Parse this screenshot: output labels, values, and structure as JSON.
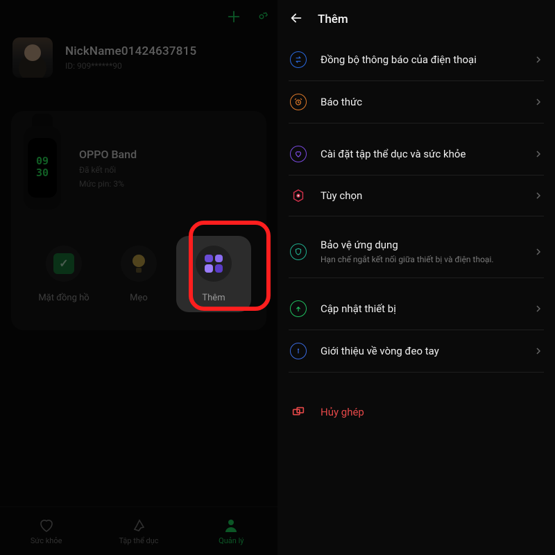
{
  "left": {
    "profile": {
      "nickname": "NickName01424637815",
      "id_label": "ID: 909******90"
    },
    "device": {
      "name": "OPPO Band",
      "status": "Đã kết nối",
      "battery": "Mức pin: 3%",
      "watch_time_top": "09",
      "watch_time_bottom": "30"
    },
    "tiles": {
      "watchface": "Mặt đồng hồ",
      "tips": "Mẹo",
      "more": "Thêm"
    },
    "tabs": {
      "health": "Sức khỏe",
      "fitness": "Tập thể dục",
      "manage": "Quản lý"
    }
  },
  "right": {
    "title": "Thêm",
    "items": {
      "sync": "Đồng bộ thông báo của điện thoại",
      "alarm": "Báo thức",
      "fitness": "Cài đặt tập thể dục và sức khỏe",
      "options": "Tùy chọn",
      "protect_title": "Bảo vệ ứng dụng",
      "protect_sub": "Hạn chế ngắt kết nối giữa thiết bị và điện thoại.",
      "update": "Cập nhật thiết bị",
      "about": "Giới thiệu về vòng đeo tay",
      "unpair": "Hủy ghép"
    }
  }
}
